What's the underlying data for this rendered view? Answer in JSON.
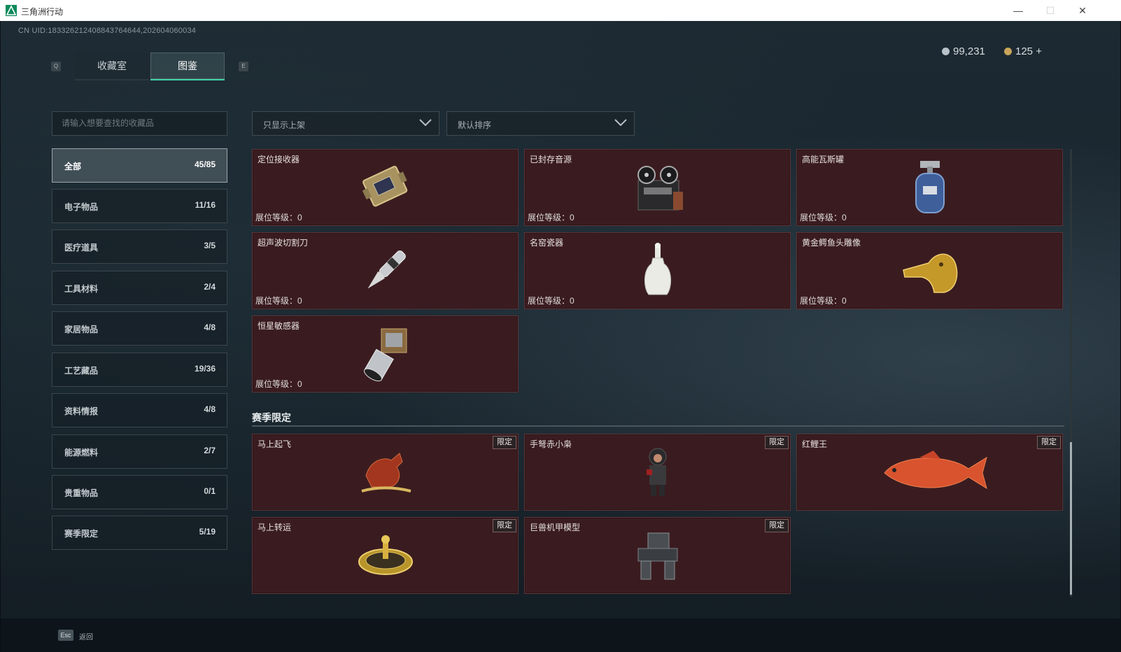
{
  "window": {
    "title": "三角洲行动",
    "minimize": "—",
    "maximize": "☐",
    "close": "✕"
  },
  "uid": "CN UID:18332621240884376464​4,202604060034",
  "tabs": {
    "left_key": "Q",
    "right_key": "E",
    "items": [
      {
        "label": "收藏室"
      },
      {
        "label": "图鉴"
      }
    ],
    "active": 1
  },
  "currency": [
    {
      "value": "99,231",
      "color": "#b8c2c8"
    },
    {
      "value": "125 +",
      "color": "#c9a45a"
    }
  ],
  "search": {
    "placeholder": "请输入想要查找的收藏品"
  },
  "categories": [
    {
      "label": "全部",
      "count": "45/85"
    },
    {
      "label": "电子物品",
      "count": "11/16"
    },
    {
      "label": "医疗道具",
      "count": "3/5"
    },
    {
      "label": "工具材料",
      "count": "2/4"
    },
    {
      "label": "家居物品",
      "count": "4/8"
    },
    {
      "label": "工艺藏品",
      "count": "19/36"
    },
    {
      "label": "资料情报",
      "count": "4/8"
    },
    {
      "label": "能源燃料",
      "count": "2/7"
    },
    {
      "label": "贵重物品",
      "count": "0/1"
    },
    {
      "label": "赛季限定",
      "count": "5/19"
    }
  ],
  "filters": {
    "display": "只显示上架",
    "sort": "默认排序"
  },
  "items": [
    {
      "name": "定位接收器",
      "level": "展位等级：0",
      "icon": "receiver-icon"
    },
    {
      "name": "已封存音源",
      "level": "展位等级：0",
      "icon": "tape-recorder-icon"
    },
    {
      "name": "高能瓦斯罐",
      "level": "展位等级：0",
      "icon": "gas-canister-icon"
    },
    {
      "name": "超声波切割刀",
      "level": "展位等级：0",
      "icon": "cutter-icon"
    },
    {
      "name": "名窑瓷器",
      "level": "展位等级：0",
      "icon": "vase-icon"
    },
    {
      "name": "黄金鳄鱼头雕像",
      "level": "展位等级：0",
      "icon": "crocodile-statue-icon"
    },
    {
      "name": "恒星敏感器",
      "level": "展位等级：0",
      "icon": "star-sensor-icon"
    }
  ],
  "season_section": {
    "title": "赛季限定",
    "badge": "限定"
  },
  "season_items": [
    {
      "name": "马上起飞",
      "icon": "horse-statue-icon"
    },
    {
      "name": "手弩赤小枭",
      "icon": "figure-icon"
    },
    {
      "name": "红鲤王",
      "icon": "carp-icon"
    },
    {
      "name": "马上转运",
      "icon": "golden-disc-icon"
    },
    {
      "name": "巨兽机甲模型",
      "icon": "mech-model-icon"
    }
  ],
  "footer": {
    "key": "Esc",
    "label": "返回"
  },
  "colors": {
    "accent": "#3fd1a6",
    "card_bg": "#3a1c20"
  }
}
